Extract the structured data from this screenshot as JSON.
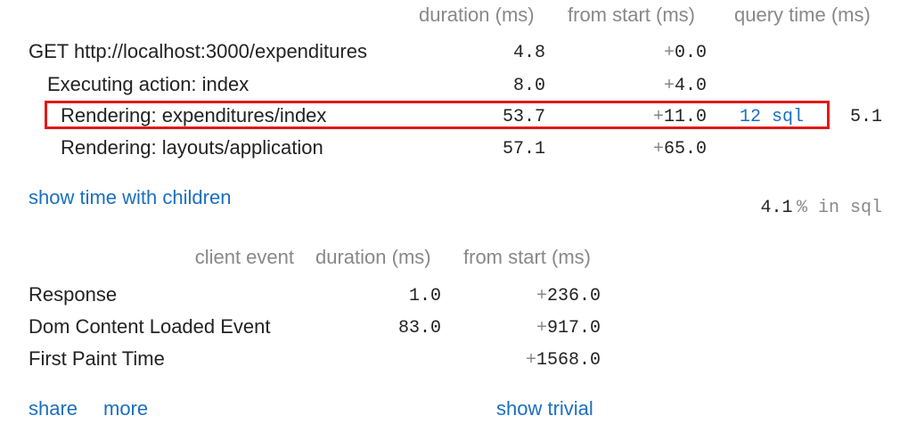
{
  "server_table": {
    "headers": {
      "duration": "duration (ms)",
      "from_start": "from start (ms)",
      "query_time": "query time (ms)"
    },
    "rows": [
      {
        "label": "GET http://localhost:3000/expenditures",
        "duration": "4.8",
        "plus": "+",
        "from_start": "0.0"
      },
      {
        "label": "Executing action: index",
        "duration": "8.0",
        "plus": "+",
        "from_start": "4.0"
      },
      {
        "label": "Rendering: expenditures/index",
        "duration": "53.7",
        "plus": "+",
        "from_start": "11.0",
        "sql_link": "12 sql",
        "query_time": "5.1"
      },
      {
        "label": "Rendering: layouts/application",
        "duration": "57.1",
        "plus": "+",
        "from_start": "65.0"
      }
    ]
  },
  "links": {
    "show_time_with_children": "show time with children",
    "share": "share",
    "more": "more",
    "show_trivial": "show trivial"
  },
  "sql_summary": {
    "value": "4.1",
    "text": "% in sql"
  },
  "client_table": {
    "headers": {
      "event": "client event",
      "duration": "duration (ms)",
      "from_start": "from start (ms)"
    },
    "rows": [
      {
        "label": "Response",
        "duration": "1.0",
        "plus": "+",
        "from_start": "236.0"
      },
      {
        "label": "Dom Content Loaded Event",
        "duration": "83.0",
        "plus": "+",
        "from_start": "917.0"
      },
      {
        "label": "First Paint Time",
        "duration": "",
        "plus": "+",
        "from_start": "1568.0"
      }
    ]
  },
  "colors": {
    "link": "#1a6fc0",
    "highlight_border": "#e31818",
    "muted": "#888888"
  }
}
